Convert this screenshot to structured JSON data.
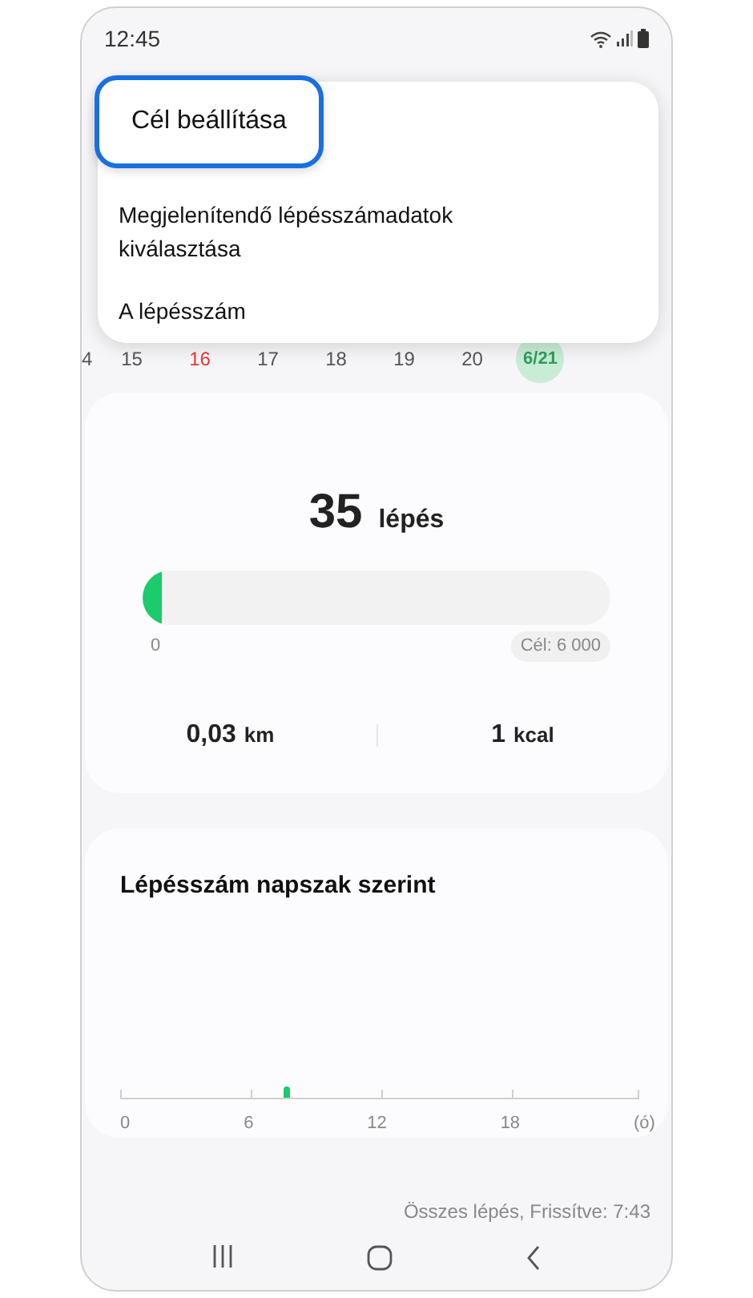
{
  "status_bar": {
    "time": "12:45"
  },
  "menu": {
    "items": [
      {
        "label": "Cél beállítása",
        "highlighted": true
      },
      {
        "label": "Megjelenítendő lépésszámadatok kiválasztása",
        "highlighted": false
      },
      {
        "label": "A lépésszám",
        "highlighted": false
      }
    ]
  },
  "days": [
    {
      "label": "4",
      "selected": false,
      "color": "#555555"
    },
    {
      "label": "15",
      "selected": false,
      "color": "#555555"
    },
    {
      "label": "16",
      "selected": false,
      "color": "#e53935"
    },
    {
      "label": "17",
      "selected": false,
      "color": "#555555"
    },
    {
      "label": "18",
      "selected": false,
      "color": "#555555"
    },
    {
      "label": "19",
      "selected": false,
      "color": "#555555"
    },
    {
      "label": "20",
      "selected": false,
      "color": "#555555"
    },
    {
      "label": "6/21",
      "selected": true,
      "color": "#2e9e5a"
    }
  ],
  "summary": {
    "steps": "35",
    "steps_unit": "lépés",
    "progress": {
      "level": 0.006,
      "start": "0",
      "goal": "Cél: 6 000"
    },
    "distance": "0,03",
    "distance_unit": "km",
    "energy": "1",
    "energy_unit": "kcal"
  },
  "hourly": {
    "title": "Lépésszám napszak szerint",
    "axis_labels": [
      "0",
      "6",
      "12",
      "18",
      "(ó)"
    ]
  },
  "footer": "Összes lépés, Frissítve: 7:43"
}
